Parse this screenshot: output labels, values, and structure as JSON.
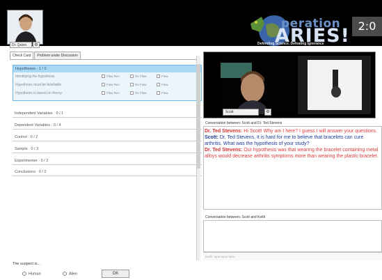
{
  "header": {
    "player_avatar_label": "Dr. Quinn",
    "logo_word_top": "peration",
    "logo_word_main": "ARIES!",
    "tagline": "Defending Science. Defeating Ignorance",
    "score": "2:0"
  },
  "tabs": [
    {
      "label": "Check Card"
    },
    {
      "label": "Problem under Discussion"
    }
  ],
  "hypotheses": {
    "title": "Hypotheses · 1 / 2",
    "rows": [
      {
        "label": "Identifying the hypothesis"
      },
      {
        "label": "Hypothesis must be falsifiable"
      },
      {
        "label": "Hypothesis is based on theory"
      }
    ],
    "options": [
      "Flaw Rec.",
      "No Flaw",
      "Flaw"
    ]
  },
  "sections": [
    {
      "label": "Independent Variables · 0 / 1"
    },
    {
      "label": "Dependent Variables · 0 / 4"
    },
    {
      "label": "Control · 0 / 2"
    },
    {
      "label": "Sample · 0 / 3"
    },
    {
      "label": "Experimenter · 0 / 2"
    },
    {
      "label": "Conclusions · 0 / 2"
    }
  ],
  "suspect": {
    "question": "The suspect is...",
    "options": [
      "Human",
      "Alien"
    ],
    "ok_label": "OK"
  },
  "video": {
    "name_plate": "Scott"
  },
  "conversation1": {
    "header": "Conversation between:  Scott and Dr. Ted Stevens",
    "lines": [
      {
        "speaker": "Dr. Ted Stevens:",
        "text": " Hi  Scott! Why am I here? I guess I will answer your questions."
      },
      {
        "speaker": "Scott:",
        "text": " Dr. Ted Stevens, It is hard for me to believe that bracelets can cure arthritis. What was the hypothesis of your study?"
      },
      {
        "speaker": "Dr. Ted Stevens:",
        "text": " Our hypothesis was that wearing the bracelet containing metal alloys would decrease arthritis symptoms more than wearing the plastic bracelet."
      }
    ]
  },
  "conversation2": {
    "header": "Conversation between:  Scott and Keith",
    "input_placeholder": "Keith: type input here"
  },
  "colors": {
    "accent_blue": "#6bb8e6",
    "header_bg": "#000000",
    "dr_text": "#e03a3a",
    "scott_text": "#1e3a9a"
  }
}
